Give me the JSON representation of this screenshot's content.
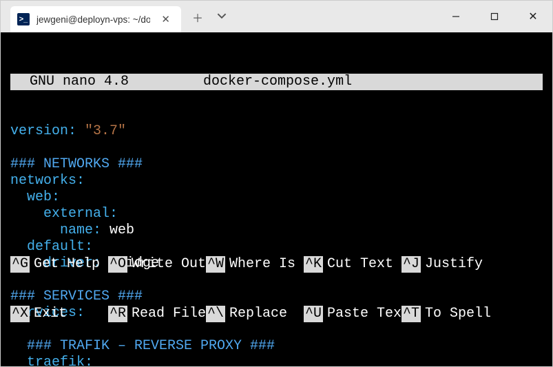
{
  "tab": {
    "title": "jewgeni@deployn-vps: ~/docke",
    "icon_text": ">_"
  },
  "nano": {
    "app": "  GNU nano 4.8",
    "filename": "docker-compose.yml"
  },
  "file": {
    "l1_k": "version:",
    "l1_v": " \"3.7\"",
    "l3": "### NETWORKS ###",
    "l4": "networks:",
    "l5": "  web:",
    "l6": "    external:",
    "l7_k": "      name:",
    "l7_v": " web",
    "l8": "  default:",
    "l9_k": "    driver:",
    "l9_v": " bridge",
    "l11": "### SERVICES ###",
    "l12": "services:",
    "l14": "  ### TRAFIK – REVERSE PROXY ###",
    "l15": "  traefik:"
  },
  "help": {
    "r1": [
      {
        "k": "^G",
        "l": "Get Help"
      },
      {
        "k": "^O",
        "l": "Write Out"
      },
      {
        "k": "^W",
        "l": "Where Is"
      },
      {
        "k": "^K",
        "l": "Cut Text"
      },
      {
        "k": "^J",
        "l": "Justify"
      }
    ],
    "r2": [
      {
        "k": "^X",
        "l": "Exit"
      },
      {
        "k": "^R",
        "l": "Read File"
      },
      {
        "k": "^\\",
        "l": "Replace"
      },
      {
        "k": "^U",
        "l": "Paste Tex"
      },
      {
        "k": "^T",
        "l": "To Spell"
      }
    ]
  }
}
